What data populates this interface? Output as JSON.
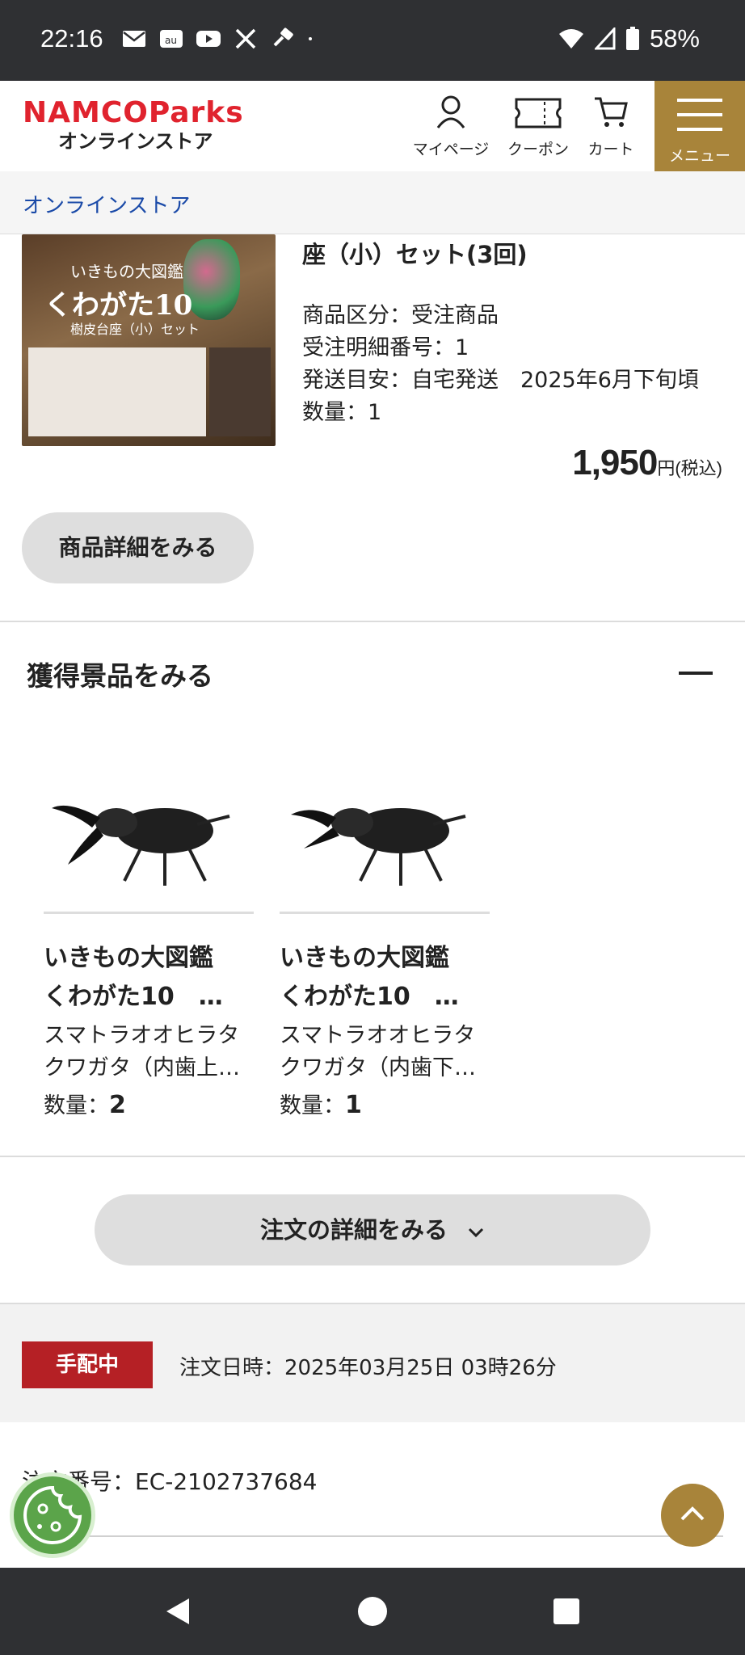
{
  "status_bar": {
    "time": "22:16",
    "battery": "58%",
    "icons_left": [
      "mail-icon",
      "au-icon",
      "youtube-icon",
      "x-icon",
      "hammer-icon",
      "dot-icon"
    ],
    "icons_right": [
      "wifi-icon",
      "signal-icon",
      "battery-icon"
    ]
  },
  "header": {
    "logo_main": "NAMCOParks",
    "logo_sub": "オンラインストア",
    "nav": [
      {
        "label": "マイページ",
        "icon": "person-icon"
      },
      {
        "label": "クーポン",
        "icon": "coupon-icon"
      },
      {
        "label": "カート",
        "icon": "cart-icon"
      }
    ],
    "menu_label": "メニュー",
    "menu_color": "#a8843a"
  },
  "breadcrumb": "オンラインストア",
  "product": {
    "image_title": "いきもの大図鑑",
    "image_big": "くわがた10",
    "image_sub": "樹皮台座（小）セット",
    "title_tail": "座（小）セット(3回)",
    "meta": [
      "商品区分：受注商品",
      "受注明細番号：1",
      "発送目安：自宅発送　2025年6月下旬頃",
      "数量：1"
    ],
    "price": "1,950",
    "price_unit": "円(税込)",
    "detail_button": "商品詳細をみる"
  },
  "prizes": {
    "section_title": "獲得景品をみる",
    "collapse_icon": "minus-icon",
    "items": [
      {
        "name_line1": "いきもの大図鑑",
        "name_line2": "くわがた10　…",
        "desc_line1": "スマトラオオヒラタ",
        "desc_line2": "クワガタ（内歯上…",
        "qty_label": "数量：",
        "qty": "2"
      },
      {
        "name_line1": "いきもの大図鑑",
        "name_line2": "くわがた10　…",
        "desc_line1": "スマトラオオヒラタ",
        "desc_line2": "クワガタ（内歯下…",
        "qty_label": "数量：",
        "qty": "1"
      }
    ]
  },
  "order": {
    "detail_button": "注文の詳細をみる",
    "status_badge": "手配中",
    "status_color": "#b52025",
    "date": "注文日時：2025年03月25日 03時26分",
    "number": "注文番号：EC-2102737684"
  },
  "floating": {
    "cookie_icon": "cookie-icon",
    "top_icon": "chevron-up-icon"
  },
  "nav_bar": [
    "back-icon",
    "home-icon",
    "recents-icon"
  ]
}
